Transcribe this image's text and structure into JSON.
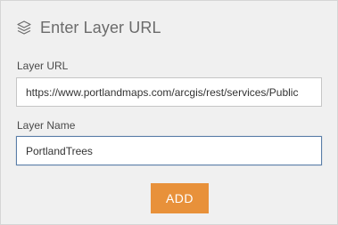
{
  "header": {
    "icon": "layers-icon",
    "title": "Enter Layer URL"
  },
  "form": {
    "url_label": "Layer URL",
    "url_value": "https://www.portlandmaps.com/arcgis/rest/services/Public",
    "name_label": "Layer Name",
    "name_value": "PortlandTrees"
  },
  "actions": {
    "add_label": "ADD"
  },
  "colors": {
    "accent": "#e8913a",
    "panel_bg": "#f0f0f0",
    "focus_border": "#5b7fa8"
  }
}
